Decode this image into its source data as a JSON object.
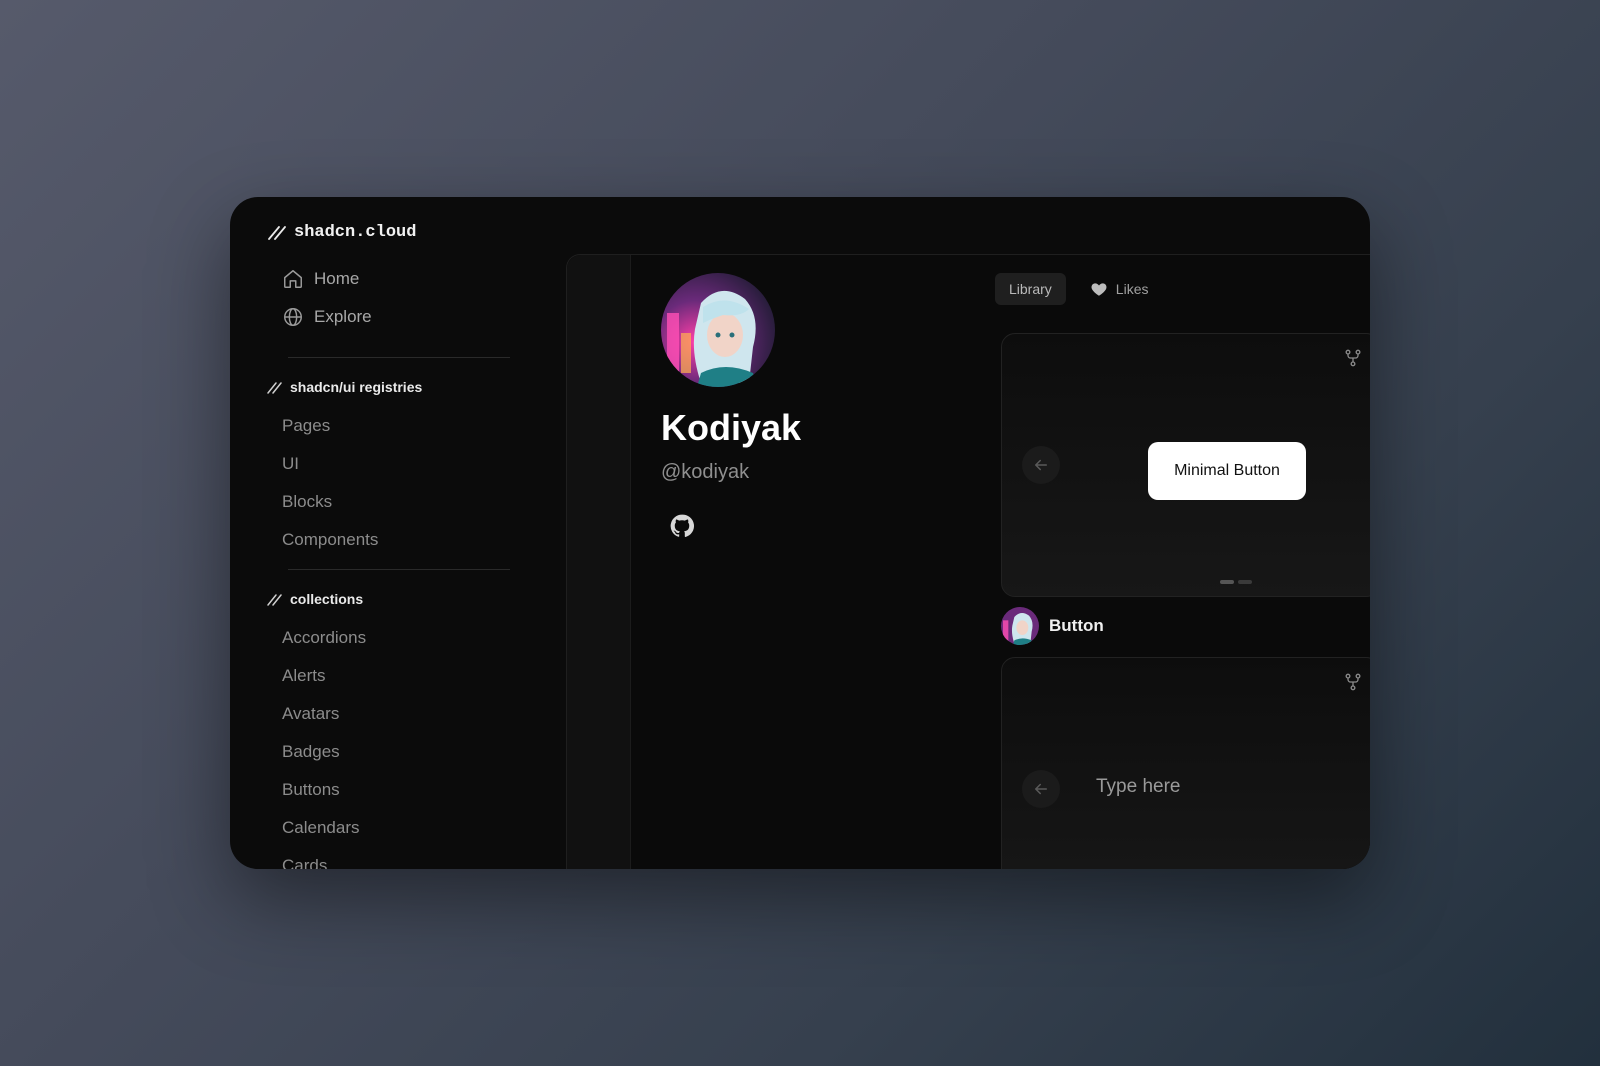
{
  "brand": {
    "name": "shadcn.cloud"
  },
  "nav": {
    "home": "Home",
    "explore": "Explore"
  },
  "registries": {
    "heading": "shadcn/ui registries",
    "items": [
      "Pages",
      "UI",
      "Blocks",
      "Components"
    ]
  },
  "collections": {
    "heading": "collections",
    "items": [
      "Accordions",
      "Alerts",
      "Avatars",
      "Badges",
      "Buttons",
      "Calendars",
      "Cards"
    ]
  },
  "profile": {
    "name": "Kodiyak",
    "handle": "@kodiyak"
  },
  "tabs": {
    "library": "Library",
    "likes": "Likes"
  },
  "cards": [
    {
      "preview_button": "Minimal Button",
      "title": "Button"
    },
    {
      "input_placeholder": "Type here"
    }
  ],
  "colors": {
    "window_bg": "#0b0b0b",
    "accent_white": "#ffffff",
    "muted_text": "#8c8c8c"
  }
}
